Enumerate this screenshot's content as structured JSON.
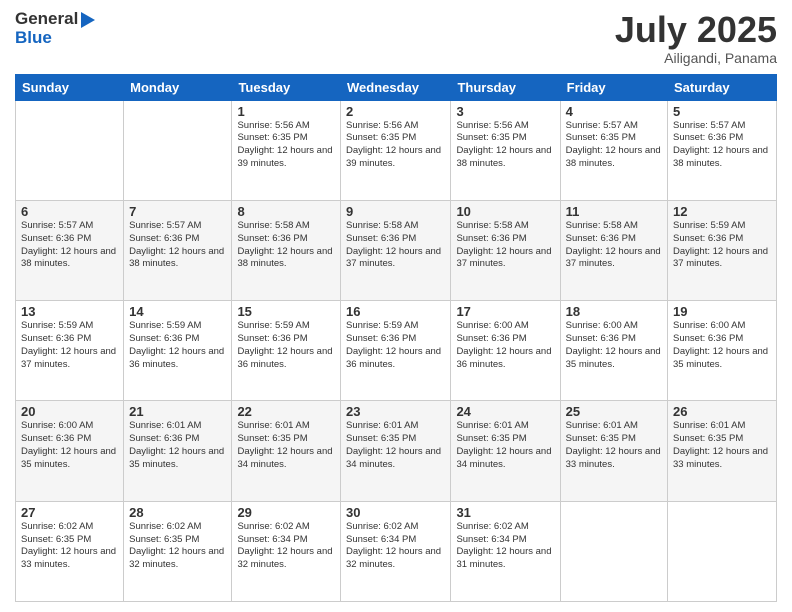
{
  "logo": {
    "line1": "General",
    "line2": "Blue"
  },
  "header": {
    "month": "July 2025",
    "location": "Ailigandi, Panama"
  },
  "weekdays": [
    "Sunday",
    "Monday",
    "Tuesday",
    "Wednesday",
    "Thursday",
    "Friday",
    "Saturday"
  ],
  "weeks": [
    [
      {
        "day": "",
        "info": ""
      },
      {
        "day": "",
        "info": ""
      },
      {
        "day": "1",
        "info": "Sunrise: 5:56 AM\nSunset: 6:35 PM\nDaylight: 12 hours and 39 minutes."
      },
      {
        "day": "2",
        "info": "Sunrise: 5:56 AM\nSunset: 6:35 PM\nDaylight: 12 hours and 39 minutes."
      },
      {
        "day": "3",
        "info": "Sunrise: 5:56 AM\nSunset: 6:35 PM\nDaylight: 12 hours and 38 minutes."
      },
      {
        "day": "4",
        "info": "Sunrise: 5:57 AM\nSunset: 6:35 PM\nDaylight: 12 hours and 38 minutes."
      },
      {
        "day": "5",
        "info": "Sunrise: 5:57 AM\nSunset: 6:36 PM\nDaylight: 12 hours and 38 minutes."
      }
    ],
    [
      {
        "day": "6",
        "info": "Sunrise: 5:57 AM\nSunset: 6:36 PM\nDaylight: 12 hours and 38 minutes."
      },
      {
        "day": "7",
        "info": "Sunrise: 5:57 AM\nSunset: 6:36 PM\nDaylight: 12 hours and 38 minutes."
      },
      {
        "day": "8",
        "info": "Sunrise: 5:58 AM\nSunset: 6:36 PM\nDaylight: 12 hours and 38 minutes."
      },
      {
        "day": "9",
        "info": "Sunrise: 5:58 AM\nSunset: 6:36 PM\nDaylight: 12 hours and 37 minutes."
      },
      {
        "day": "10",
        "info": "Sunrise: 5:58 AM\nSunset: 6:36 PM\nDaylight: 12 hours and 37 minutes."
      },
      {
        "day": "11",
        "info": "Sunrise: 5:58 AM\nSunset: 6:36 PM\nDaylight: 12 hours and 37 minutes."
      },
      {
        "day": "12",
        "info": "Sunrise: 5:59 AM\nSunset: 6:36 PM\nDaylight: 12 hours and 37 minutes."
      }
    ],
    [
      {
        "day": "13",
        "info": "Sunrise: 5:59 AM\nSunset: 6:36 PM\nDaylight: 12 hours and 37 minutes."
      },
      {
        "day": "14",
        "info": "Sunrise: 5:59 AM\nSunset: 6:36 PM\nDaylight: 12 hours and 36 minutes."
      },
      {
        "day": "15",
        "info": "Sunrise: 5:59 AM\nSunset: 6:36 PM\nDaylight: 12 hours and 36 minutes."
      },
      {
        "day": "16",
        "info": "Sunrise: 5:59 AM\nSunset: 6:36 PM\nDaylight: 12 hours and 36 minutes."
      },
      {
        "day": "17",
        "info": "Sunrise: 6:00 AM\nSunset: 6:36 PM\nDaylight: 12 hours and 36 minutes."
      },
      {
        "day": "18",
        "info": "Sunrise: 6:00 AM\nSunset: 6:36 PM\nDaylight: 12 hours and 35 minutes."
      },
      {
        "day": "19",
        "info": "Sunrise: 6:00 AM\nSunset: 6:36 PM\nDaylight: 12 hours and 35 minutes."
      }
    ],
    [
      {
        "day": "20",
        "info": "Sunrise: 6:00 AM\nSunset: 6:36 PM\nDaylight: 12 hours and 35 minutes."
      },
      {
        "day": "21",
        "info": "Sunrise: 6:01 AM\nSunset: 6:36 PM\nDaylight: 12 hours and 35 minutes."
      },
      {
        "day": "22",
        "info": "Sunrise: 6:01 AM\nSunset: 6:35 PM\nDaylight: 12 hours and 34 minutes."
      },
      {
        "day": "23",
        "info": "Sunrise: 6:01 AM\nSunset: 6:35 PM\nDaylight: 12 hours and 34 minutes."
      },
      {
        "day": "24",
        "info": "Sunrise: 6:01 AM\nSunset: 6:35 PM\nDaylight: 12 hours and 34 minutes."
      },
      {
        "day": "25",
        "info": "Sunrise: 6:01 AM\nSunset: 6:35 PM\nDaylight: 12 hours and 33 minutes."
      },
      {
        "day": "26",
        "info": "Sunrise: 6:01 AM\nSunset: 6:35 PM\nDaylight: 12 hours and 33 minutes."
      }
    ],
    [
      {
        "day": "27",
        "info": "Sunrise: 6:02 AM\nSunset: 6:35 PM\nDaylight: 12 hours and 33 minutes."
      },
      {
        "day": "28",
        "info": "Sunrise: 6:02 AM\nSunset: 6:35 PM\nDaylight: 12 hours and 32 minutes."
      },
      {
        "day": "29",
        "info": "Sunrise: 6:02 AM\nSunset: 6:34 PM\nDaylight: 12 hours and 32 minutes."
      },
      {
        "day": "30",
        "info": "Sunrise: 6:02 AM\nSunset: 6:34 PM\nDaylight: 12 hours and 32 minutes."
      },
      {
        "day": "31",
        "info": "Sunrise: 6:02 AM\nSunset: 6:34 PM\nDaylight: 12 hours and 31 minutes."
      },
      {
        "day": "",
        "info": ""
      },
      {
        "day": "",
        "info": ""
      }
    ]
  ]
}
